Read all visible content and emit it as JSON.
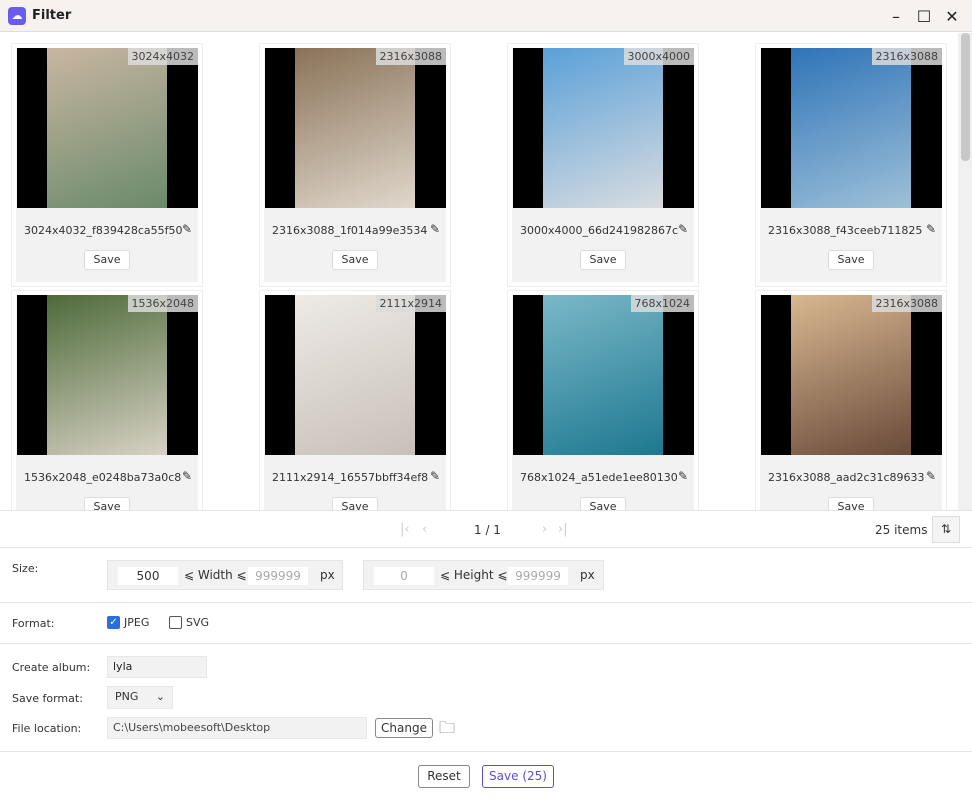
{
  "window": {
    "title": "Filter",
    "logo_icon": "cloud-icon"
  },
  "images": [
    {
      "dim": "3024x4032",
      "name": "3024x4032_f839428ca55f50",
      "save": "Save",
      "color1": "#c9b6a2",
      "color2": "#6a8a6a"
    },
    {
      "dim": "2316x3088",
      "name": "2316x3088_1f014a99e3534",
      "save": "Save",
      "color1": "#8a7258",
      "color2": "#e0d8cc"
    },
    {
      "dim": "3000x4000",
      "name": "3000x4000_66d241982867c",
      "save": "Save",
      "color1": "#5aa0d8",
      "color2": "#d8dce0"
    },
    {
      "dim": "2316x3088",
      "name": "2316x3088_f43ceeb711825",
      "save": "Save",
      "color1": "#2f74b8",
      "color2": "#9ec0d8"
    },
    {
      "dim": "1536x2048",
      "name": "1536x2048_e0248ba73a0c8",
      "save": "Save",
      "color1": "#4d6a3a",
      "color2": "#d8d2c4"
    },
    {
      "dim": "2111x2914",
      "name": "2111x2914_16557bbff34ef8",
      "save": "Save",
      "color1": "#eeeae6",
      "color2": "#c8c0b8"
    },
    {
      "dim": "768x1024",
      "name": "768x1024_a51ede1ee80130",
      "save": "Save",
      "color1": "#7ab8c8",
      "color2": "#1e7890"
    },
    {
      "dim": "2316x3088",
      "name": "2316x3088_aad2c31c89633",
      "save": "Save",
      "color1": "#d8b890",
      "color2": "#6a4a3a"
    }
  ],
  "pager": {
    "page": "1 / 1",
    "count": "25 items"
  },
  "size": {
    "label": "Size:",
    "width_min": "500",
    "width_label": "⩽ Width ⩽",
    "width_max_placeholder": "999999",
    "unit": "px",
    "height_min_placeholder": "0",
    "height_label": "⩽ Height ⩽",
    "height_max_placeholder": "999999"
  },
  "format": {
    "label": "Format:",
    "jpeg": "JPEG",
    "jpeg_checked": true,
    "svg": "SVG",
    "svg_checked": false
  },
  "album": {
    "label": "Create album:",
    "value": "lyla"
  },
  "save_format": {
    "label": "Save format:",
    "value": "PNG"
  },
  "location": {
    "label": "File location:",
    "value": "C:\\Users\\mobeesoft\\Desktop",
    "change": "Change"
  },
  "footer": {
    "reset": "Reset",
    "save": "Save (25)"
  },
  "colors": {
    "accent": "#5b4fd6"
  }
}
